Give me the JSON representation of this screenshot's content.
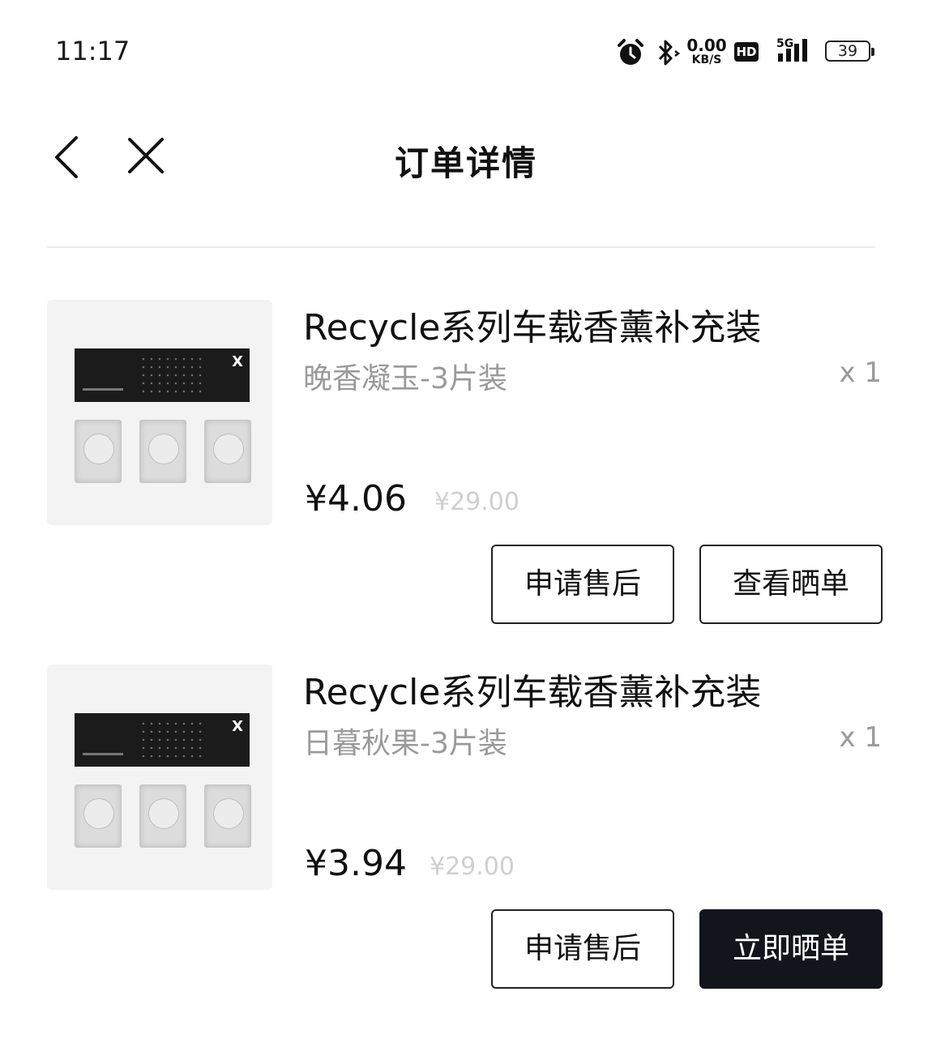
{
  "status": {
    "time": "11:17",
    "net_speed": "0.00",
    "net_unit": "KB/S",
    "hd": "HD",
    "network": "5G",
    "battery": "39"
  },
  "nav": {
    "title": "订单详情"
  },
  "items": [
    {
      "title": "Recycle系列车载香薰补充装",
      "variant": "晚香凝玉-3片装",
      "qty": "x 1",
      "price": "¥4.06",
      "original_price": "¥29.00",
      "btn_left": "申请售后",
      "btn_right": "查看晒单",
      "btn_right_style": "outline"
    },
    {
      "title": "Recycle系列车载香薰补充装",
      "variant": "日暮秋果-3片装",
      "qty": "x 1",
      "price": "¥3.94",
      "original_price": "¥29.00",
      "btn_left": "申请售后",
      "btn_right": "立即晒单",
      "btn_right_style": "filled"
    }
  ]
}
